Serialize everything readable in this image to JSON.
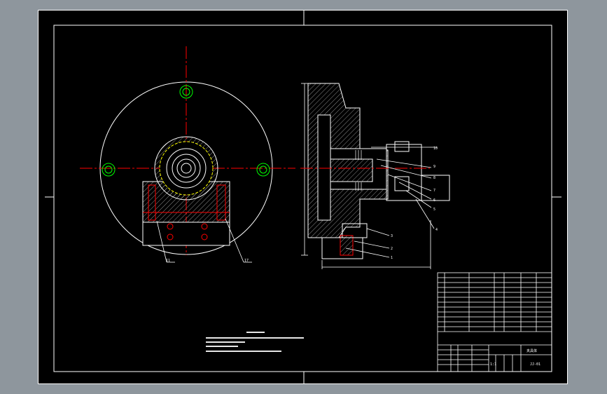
{
  "colors": {
    "background": "#8e969d",
    "sheet": "#000000",
    "line": "#ffffff",
    "center_line": "#ff0000",
    "hidden_line": "#ffff00",
    "section": "#00ff00",
    "hatch": "#d0d0d0"
  },
  "leaders": {
    "front_left": "11",
    "front_right": "17",
    "side": [
      "10",
      "9",
      "8",
      "7",
      "6",
      "5",
      "4",
      "3",
      "2",
      "1"
    ]
  },
  "title_block": {
    "part_name": "夹具体",
    "drawing_no": "JJ-01",
    "scale": "1:1"
  }
}
